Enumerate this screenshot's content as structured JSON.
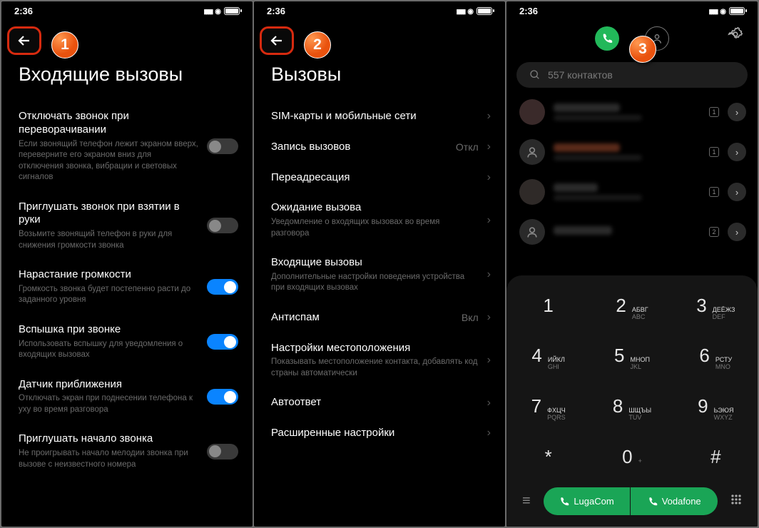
{
  "status": {
    "time": "2:36"
  },
  "markers": {
    "one": "1",
    "two": "2",
    "three": "3"
  },
  "p1": {
    "title": "Входящие вызовы",
    "rows": [
      {
        "label": "Отключать звонок при переворачивании",
        "desc": "Если звонящий телефон лежит экраном вверх, переверните его экраном вниз для отключения звонка, вибрации и световых сигналов",
        "toggle": false
      },
      {
        "label": "Приглушать звонок при взятии в руки",
        "desc": "Возьмите звонящий телефон в руки для снижения громкости звонка",
        "toggle": false
      },
      {
        "label": "Нарастание громкости",
        "desc": "Громкость звонка будет постепенно расти до заданного уровня",
        "toggle": true
      },
      {
        "label": "Вспышка при звонке",
        "desc": "Использовать вспышку для уведомления о входящих вызовах",
        "toggle": true
      },
      {
        "label": "Датчик приближения",
        "desc": "Отключать экран при поднесении телефона к уху во время разговора",
        "toggle": true
      },
      {
        "label": "Приглушать начало звонка",
        "desc": "Не проигрывать начало мелодии звонка при вызове с неизвестного номера",
        "toggle": false
      }
    ]
  },
  "p2": {
    "title": "Вызовы",
    "rows": [
      {
        "label": "SIM-карты и мобильные сети"
      },
      {
        "label": "Запись вызовов",
        "value": "Откл"
      },
      {
        "label": "Переадресация"
      },
      {
        "label": "Ожидание вызова",
        "desc": "Уведомление о входящих вызовах во время разговора"
      },
      {
        "label": "Входящие вызовы",
        "desc": "Дополнительные настройки поведения устройства при входящих вызовах"
      },
      {
        "label": "Антиспам",
        "value": "Вкл"
      },
      {
        "label": "Настройки местоположения",
        "desc": "Показывать местоположение контакта, добавлять код страны автоматически"
      },
      {
        "label": "Автоответ"
      },
      {
        "label": "Расширенные настройки"
      }
    ]
  },
  "p3": {
    "search_placeholder": "557 контактов",
    "contacts_badges": [
      "1",
      "1",
      "1",
      "2"
    ],
    "keypad": [
      [
        {
          "d": "1",
          "c": "",
          "l": ""
        },
        {
          "d": "2",
          "c": "АБВГ",
          "l": "ABC"
        },
        {
          "d": "3",
          "c": "ДЕЁЖЗ",
          "l": "DEF"
        }
      ],
      [
        {
          "d": "4",
          "c": "ИЙКЛ",
          "l": "GHI"
        },
        {
          "d": "5",
          "c": "МНОП",
          "l": "JKL"
        },
        {
          "d": "6",
          "c": "РСТУ",
          "l": "MNO"
        }
      ],
      [
        {
          "d": "7",
          "c": "ФХЦЧ",
          "l": "PQRS"
        },
        {
          "d": "8",
          "c": "ШЩЪЫ",
          "l": "TUV"
        },
        {
          "d": "9",
          "c": "ЬЭЮЯ",
          "l": "WXYZ"
        }
      ],
      [
        {
          "d": "*",
          "c": "",
          "l": ""
        },
        {
          "d": "0",
          "c": "",
          "l": "+"
        },
        {
          "d": "#",
          "c": "",
          "l": ""
        }
      ]
    ],
    "sim1": "LugaCom",
    "sim2": "Vodafone"
  }
}
